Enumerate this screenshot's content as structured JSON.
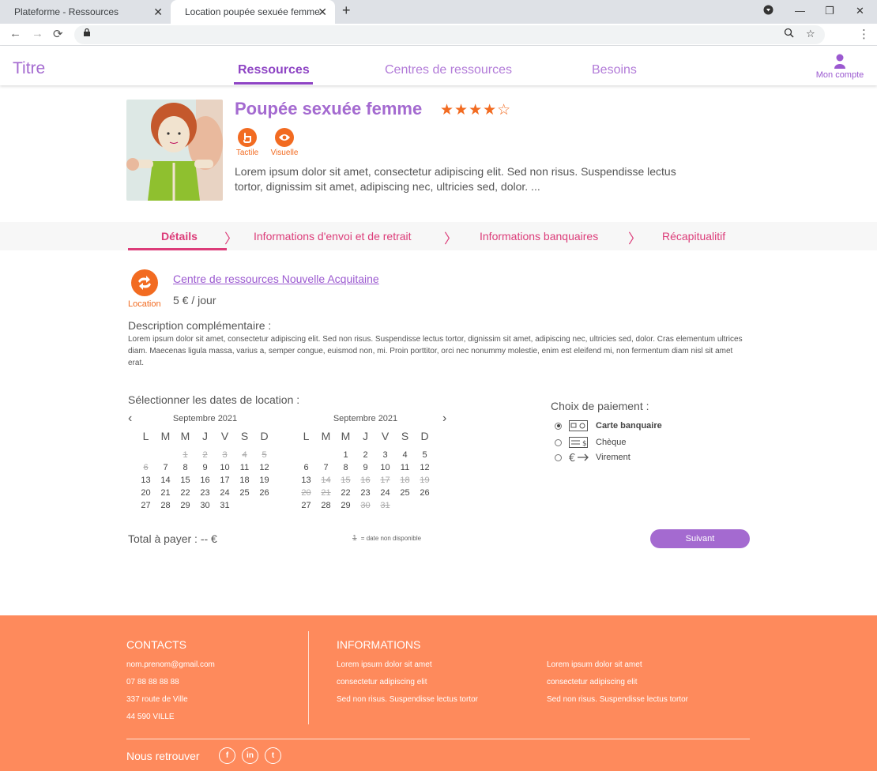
{
  "browser": {
    "tabs": [
      {
        "label": "Plateforme - Ressources"
      },
      {
        "label": "Location poupée sexuée femme"
      }
    ],
    "new_tab": "+",
    "close": "✕"
  },
  "header": {
    "brand": "Titre",
    "nav": [
      {
        "label": "Ressources",
        "active": true
      },
      {
        "label": "Centres de ressources",
        "active": false
      },
      {
        "label": "Besoins",
        "active": false
      }
    ],
    "account": "Mon compte"
  },
  "product": {
    "title": "Poupée sexuée femme",
    "rating": 4,
    "rating_max": 5,
    "stars": "★★★★☆",
    "senses": [
      {
        "label": "Tactile",
        "icon": "hand-icon"
      },
      {
        "label": "Visuelle",
        "icon": "eye-icon"
      }
    ],
    "description": "Lorem ipsum dolor sit amet, consectetur adipiscing elit. Sed non risus. Suspendisse lectus tortor, dignissim sit amet, adipiscing nec, ultricies sed, dolor. ..."
  },
  "steps": [
    {
      "label": "Détails",
      "active": true
    },
    {
      "label": "Informations d'envoi et de retrait",
      "active": false
    },
    {
      "label": "Informations banquaires",
      "active": false
    },
    {
      "label": "Récapitualitif",
      "active": false
    }
  ],
  "steps_separator": "〉",
  "centre": {
    "mode": "Location",
    "name": "Centre de ressources Nouvelle Acquitaine",
    "price": "5 € / jour"
  },
  "extra_desc": {
    "heading": "Description complémentaire :",
    "text": "Lorem ipsum dolor sit amet, consectetur adipiscing elit. Sed non risus. Suspendisse lectus tortor, dignissim sit amet, adipiscing nec, ultricies sed, dolor. Cras elementum ultrices diam. Maecenas ligula massa, varius a, semper congue, euismod non, mi. Proin porttitor, orci nec nonummy molestie, enim est eleifend mi, non fermentum diam nisl sit amet erat."
  },
  "calendar": {
    "heading": "Sélectionner les dates de  location :",
    "prev": "‹",
    "next": "›",
    "weekdays": [
      "L",
      "M",
      "M",
      "J",
      "V",
      "S",
      "D"
    ],
    "months": [
      {
        "title": "Septembre 2021",
        "weeks": [
          [
            {
              "d": ""
            },
            {
              "d": ""
            },
            {
              "d": "1",
              "na": true
            },
            {
              "d": "2",
              "na": true
            },
            {
              "d": "3",
              "na": true
            },
            {
              "d": "4",
              "na": true
            },
            {
              "d": "5",
              "na": true
            }
          ],
          [
            {
              "d": "6",
              "na": true
            },
            {
              "d": "7"
            },
            {
              "d": "8"
            },
            {
              "d": "9"
            },
            {
              "d": "10"
            },
            {
              "d": "11"
            },
            {
              "d": "12"
            }
          ],
          [
            {
              "d": "13"
            },
            {
              "d": "14"
            },
            {
              "d": "15"
            },
            {
              "d": "16"
            },
            {
              "d": "17"
            },
            {
              "d": "18"
            },
            {
              "d": "19"
            }
          ],
          [
            {
              "d": "20"
            },
            {
              "d": "21"
            },
            {
              "d": "22"
            },
            {
              "d": "23"
            },
            {
              "d": "24"
            },
            {
              "d": "25"
            },
            {
              "d": "26"
            }
          ],
          [
            {
              "d": "27"
            },
            {
              "d": "28"
            },
            {
              "d": "29"
            },
            {
              "d": "30"
            },
            {
              "d": "31"
            },
            {
              "d": ""
            },
            {
              "d": ""
            }
          ]
        ]
      },
      {
        "title": "Septembre 2021",
        "weeks": [
          [
            {
              "d": ""
            },
            {
              "d": ""
            },
            {
              "d": "1"
            },
            {
              "d": "2"
            },
            {
              "d": "3"
            },
            {
              "d": "4"
            },
            {
              "d": "5"
            }
          ],
          [
            {
              "d": "6"
            },
            {
              "d": "7"
            },
            {
              "d": "8"
            },
            {
              "d": "9"
            },
            {
              "d": "10"
            },
            {
              "d": "11"
            },
            {
              "d": "12"
            }
          ],
          [
            {
              "d": "13"
            },
            {
              "d": "14",
              "na": true
            },
            {
              "d": "15",
              "na": true
            },
            {
              "d": "16",
              "na": true
            },
            {
              "d": "17",
              "na": true
            },
            {
              "d": "18",
              "na": true
            },
            {
              "d": "19",
              "na": true
            }
          ],
          [
            {
              "d": "20",
              "na": true
            },
            {
              "d": "21",
              "na": true
            },
            {
              "d": "22"
            },
            {
              "d": "23"
            },
            {
              "d": "24"
            },
            {
              "d": "25"
            },
            {
              "d": "26"
            }
          ],
          [
            {
              "d": "27"
            },
            {
              "d": "28"
            },
            {
              "d": "29"
            },
            {
              "d": "30",
              "na": true
            },
            {
              "d": "31",
              "na": true
            },
            {
              "d": ""
            },
            {
              "d": ""
            }
          ]
        ]
      }
    ],
    "legend_symbol": "1",
    "legend_text": "= date non disponible"
  },
  "payment": {
    "heading": "Choix de paiement :",
    "options": [
      {
        "label": "Carte banquaire",
        "selected": true,
        "icon": "credit-card-icon"
      },
      {
        "label": "Chèque",
        "selected": false,
        "icon": "cheque-icon"
      },
      {
        "label": "Virement",
        "selected": false,
        "icon": "bank-transfer-icon"
      }
    ]
  },
  "total": "Total à payer : -- €",
  "next_button": "Suivant",
  "footer": {
    "contacts_heading": "CONTACTS",
    "contacts": [
      "nom.prenom@gmail.com",
      "07 88 88 88 88",
      "337 route de Ville",
      "44 590 VILLE"
    ],
    "info_heading": "INFORMATIONS",
    "info_col1": [
      "Lorem ipsum dolor sit amet",
      "consectetur adipiscing elit",
      "Sed non risus. Suspendisse lectus tortor"
    ],
    "info_col2": [
      "Lorem ipsum dolor sit amet",
      "consectetur adipiscing elit",
      "Sed non risus. Suspendisse lectus tortor"
    ],
    "find_us": "Nous retrouver",
    "social": [
      {
        "name": "facebook-icon",
        "glyph": "f"
      },
      {
        "name": "linkedin-icon",
        "glyph": "in"
      },
      {
        "name": "twitter-icon",
        "glyph": "t"
      }
    ]
  },
  "colors": {
    "brand_purple": "#a46ad0",
    "accent_orange": "#f26b21",
    "step_pink": "#dc3c79",
    "footer_bg": "#fe8a5c"
  }
}
